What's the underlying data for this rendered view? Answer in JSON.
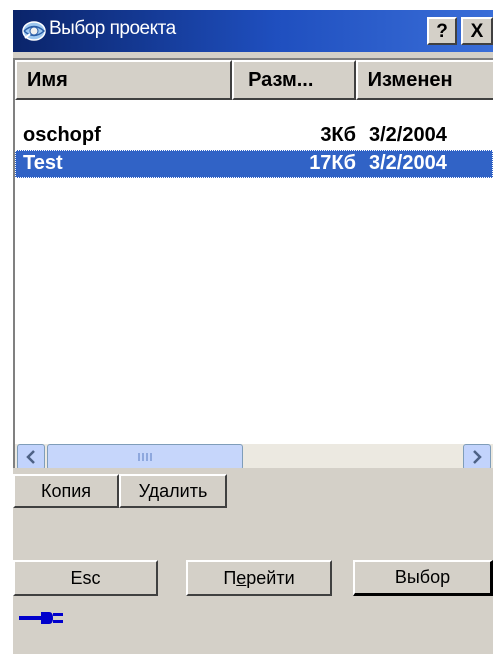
{
  "window": {
    "title": "Выбор проекта",
    "help_label": "?",
    "close_label": "X"
  },
  "list": {
    "columns": [
      "Имя",
      "Разм...",
      "Изменен"
    ],
    "rows": [
      {
        "name": "oschopf",
        "size": "3Кб",
        "modified": "3/2/2004",
        "selected": false
      },
      {
        "name": "Test",
        "size": "17Кб",
        "modified": "3/2/2004",
        "selected": true
      }
    ]
  },
  "buttons": {
    "copy": "Копия",
    "delete": "Удалить",
    "esc": "Esc",
    "goto_prefix": "П",
    "goto_accel": "е",
    "goto_suffix": "рейти",
    "select": "Выбор"
  },
  "icons": {
    "app": "globe-icon",
    "plug": "plug-icon",
    "scroll_left": "arrow-left-icon",
    "scroll_right": "arrow-right-icon"
  },
  "colors": {
    "titlebar": "#0a246a",
    "selection": "#3163c6",
    "scrollbar": "#c2d3fc"
  }
}
